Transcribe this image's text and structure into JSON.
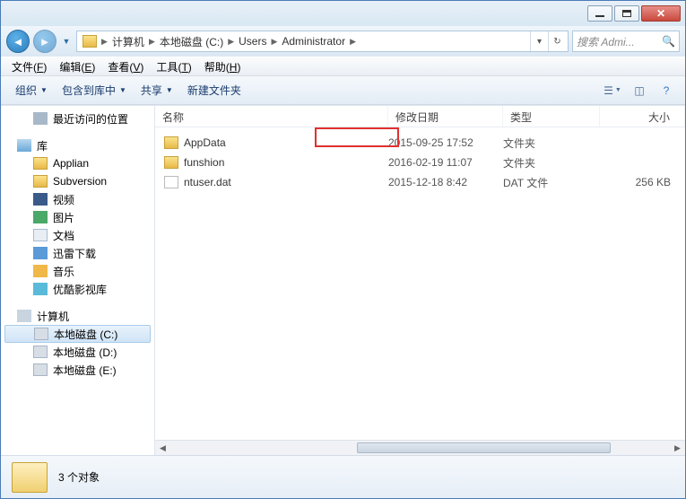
{
  "titlebar": {},
  "addressbar": {
    "crumbs": [
      "计算机",
      "本地磁盘 (C:)",
      "Users",
      "Administrator"
    ],
    "search_placeholder": "搜索 Admi..."
  },
  "menubar": {
    "items": [
      {
        "label": "文件",
        "accel": "F"
      },
      {
        "label": "编辑",
        "accel": "E"
      },
      {
        "label": "查看",
        "accel": "V"
      },
      {
        "label": "工具",
        "accel": "T"
      },
      {
        "label": "帮助",
        "accel": "H"
      }
    ]
  },
  "toolbar": {
    "organize": "组织",
    "include": "包含到库中",
    "share": "共享",
    "newfolder": "新建文件夹"
  },
  "sidebar": {
    "recent": "最近访问的位置",
    "lib": "库",
    "lib_items": [
      "Applian",
      "Subversion",
      "视频",
      "图片",
      "文档",
      "迅雷下载",
      "音乐",
      "优酷影视库"
    ],
    "computer": "计算机",
    "drives": [
      "本地磁盘 (C:)",
      "本地磁盘 (D:)",
      "本地磁盘 (E:)"
    ]
  },
  "columns": {
    "name": "名称",
    "date": "修改日期",
    "type": "类型",
    "size": "大小"
  },
  "files": [
    {
      "name": "AppData",
      "date": "2015-09-25 17:52",
      "type": "文件夹",
      "size": "",
      "kind": "folder",
      "highlighted": true
    },
    {
      "name": "funshion",
      "date": "2016-02-19 11:07",
      "type": "文件夹",
      "size": "",
      "kind": "folder"
    },
    {
      "name": "ntuser.dat",
      "date": "2015-12-18 8:42",
      "type": "DAT 文件",
      "size": "256 KB",
      "kind": "file"
    }
  ],
  "status": {
    "count": "3 个对象"
  }
}
